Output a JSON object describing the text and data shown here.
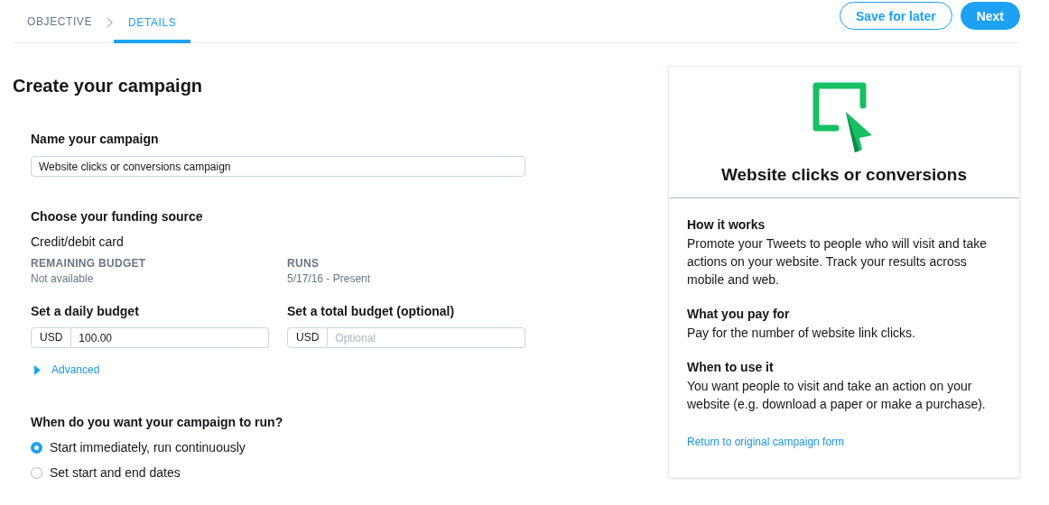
{
  "breadcrumb": [
    {
      "label": "OBJECTIVE",
      "selected": false
    },
    {
      "label": "DETAILS",
      "selected": true
    }
  ],
  "actions": [
    {
      "label": "Save for later",
      "kind": "secondary"
    },
    {
      "label": "Next",
      "kind": "primary"
    }
  ],
  "form": {
    "title": "Create your campaign",
    "name_section": {
      "label": "Name your campaign",
      "value": "Website clicks or conversions campaign"
    },
    "funding": {
      "label": "Choose your funding source",
      "source": "Credit/debit card",
      "stats": [
        {
          "label": "REMAINING BUDGET",
          "value": "Not available"
        },
        {
          "label": "RUNS",
          "value": "5/17/16 - Present"
        }
      ]
    },
    "budgets": [
      {
        "label": "Set a daily budget",
        "currency": "USD",
        "value": "100.00"
      },
      {
        "label": "Set a total budget (optional)",
        "currency": "USD",
        "placeholder": "Optional"
      }
    ],
    "advanced": {
      "label": "Advanced",
      "expanded": false
    },
    "schedule": {
      "label": "When do you want your campaign to run?",
      "options": [
        {
          "label": "Start immediately, run continuously",
          "selected": true
        },
        {
          "label": "Set start and end dates",
          "selected": false
        }
      ]
    }
  },
  "objective_card": {
    "title": "Website clicks or conversions",
    "sections": [
      {
        "heading": "How it works",
        "text": "Promote your Tweets to people who will visit and take actions on your website. Track your results across mobile and web."
      },
      {
        "heading": "What you pay for",
        "text": "Pay for the number of website link clicks."
      },
      {
        "heading": "When to use it",
        "text": "You want people to visit and take an action on your website (e.g. download a paper or make a purchase)."
      }
    ],
    "link": "Return to original campaign form"
  }
}
